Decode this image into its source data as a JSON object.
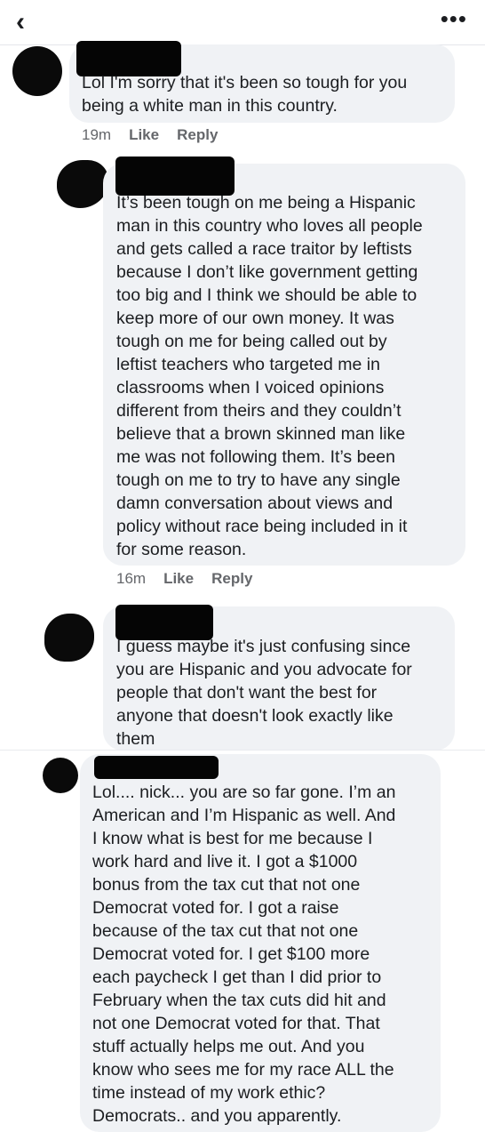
{
  "header": {
    "back_icon": "‹",
    "more_icon": "•••"
  },
  "comments": [
    {
      "text": "Lol I'm sorry that it's been so tough for you\nbeing a white man in this country.",
      "time": "19m",
      "like": "Like",
      "reply": "Reply"
    },
    {
      "text": "It’s been tough on me being a Hispanic\nman in this country who loves all people\nand gets called a race traitor by leftists\nbecause I don’t like government getting\ntoo big and I think we should be able to\nkeep more of our own money.  It was\ntough on me for being called out by\nleftist teachers who targeted me in\nclassrooms when I voiced opinions\ndifferent from theirs and they couldn’t\nbelieve that a brown skinned man like\nme was not following them.  It’s been\ntough on me to try to have any single\ndamn conversation about views and\npolicy without race being included in it\nfor some reason.",
      "time": "16m",
      "like": "Like",
      "reply": "Reply"
    },
    {
      "text": "I guess maybe it's just confusing since\nyou are Hispanic and you advocate for\npeople that don't want the best for\nanyone that doesn't look exactly like\nthem"
    },
    {
      "text": "Lol.... nick... you are so far gone. I’m an\nAmerican and I’m Hispanic as well.  And\nI know what is best for me because I\nwork hard and live it.  I got a $1000\nbonus from the tax cut that not one\nDemocrat voted for.  I got a raise\nbecause of the tax cut that not one\nDemocrat voted for.  I get $100 more\neach paycheck I get than I did prior to\nFebruary when the tax cuts did hit and\nnot one Democrat voted for that.  That\nstuff actually helps me out. And you\nknow who sees me for my race ALL the\ntime instead of my work ethic?\nDemocrats.. and you apparently."
    }
  ]
}
